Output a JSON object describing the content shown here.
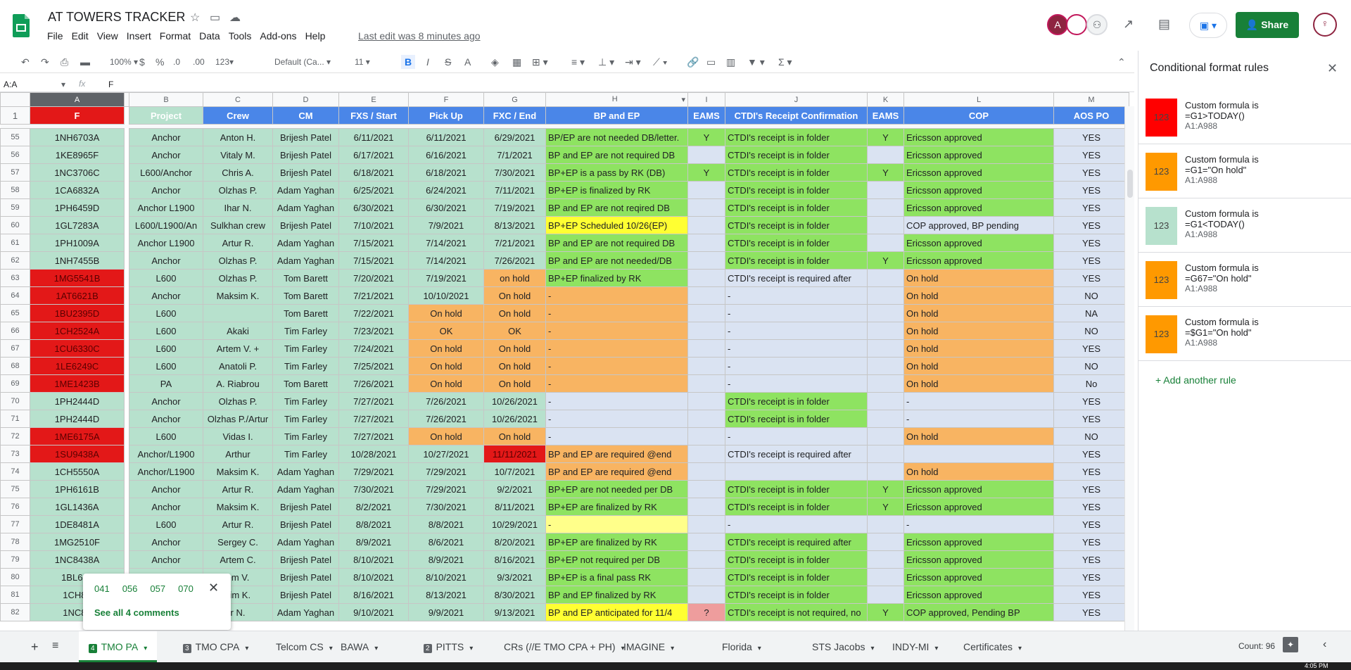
{
  "doc": {
    "title": "AT TOWERS TRACKER",
    "last_edit": "Last edit was 8 minutes ago"
  },
  "menu": [
    "File",
    "Edit",
    "View",
    "Insert",
    "Format",
    "Data",
    "Tools",
    "Add-ons",
    "Help"
  ],
  "header": {
    "avatar_letter": "A",
    "share_label": "Share"
  },
  "toolbar": {
    "zoom": "100%",
    "currency": "$",
    "percent": "%",
    "dec_dec": ".0",
    "dec_inc": ".00",
    "format_more": "123",
    "font": "Default (Ca...",
    "size": "11",
    "bold": "B",
    "italic": "I",
    "strike": "S",
    "textcolor": "A"
  },
  "formula": {
    "name_box": "A:A",
    "fx": "fx",
    "value": "F"
  },
  "columns": [
    "A",
    "B",
    "C",
    "D",
    "E",
    "F",
    "G",
    "H",
    "I",
    "J",
    "K",
    "L",
    "M"
  ],
  "headers": [
    "F",
    "Project",
    "Crew",
    "CM",
    "FXS / Start",
    "Pick Up",
    "FXC / End",
    "BP and EP",
    "EAMS",
    "CTDI's Receipt Confirmation",
    "EAMS",
    "COP",
    "AOS PO"
  ],
  "header_row_num": "1",
  "rows": [
    {
      "n": "55",
      "c": [
        "1NH6703A",
        "Anchor",
        "Anton H.",
        "Brijesh Patel",
        "6/11/2021",
        "6/11/2021",
        "6/29/2021",
        "BP/EP are not needed DB/letter.",
        "Y",
        "CTDI's receipt is in folder",
        "Y",
        "Ericsson approved",
        "YES"
      ],
      "s": [
        "teal",
        "teal",
        "teal",
        "teal",
        "teal",
        "teal",
        "teal",
        "green",
        "green",
        "green",
        "green",
        "green",
        "blue"
      ]
    },
    {
      "n": "56",
      "c": [
        "1KE8965F",
        "Anchor",
        "Vitaly M.",
        "Brijesh Patel",
        "6/17/2021",
        "6/16/2021",
        "7/1/2021",
        "BP and EP are not required DB",
        "",
        "CTDI's receipt is in folder",
        "",
        "Ericsson approved",
        "YES"
      ],
      "s": [
        "teal",
        "teal",
        "teal",
        "teal",
        "teal",
        "teal",
        "teal",
        "green",
        "blue",
        "green",
        "blue",
        "green",
        "blue"
      ]
    },
    {
      "n": "57",
      "c": [
        "1NC3706C",
        "L600/Anchor",
        "Chris A.",
        "Brijesh Patel",
        "6/18/2021",
        "6/18/2021",
        "7/30/2021",
        "BP+EP is a pass by RK (DB)",
        "Y",
        "CTDI's receipt is in folder",
        "Y",
        "Ericsson approved",
        "YES"
      ],
      "s": [
        "teal",
        "teal",
        "teal",
        "teal",
        "teal",
        "teal",
        "teal",
        "green",
        "green",
        "green",
        "green",
        "green",
        "blue"
      ]
    },
    {
      "n": "58",
      "c": [
        "1CA6832A",
        "Anchor",
        "Olzhas P.",
        "Adam Yaghan",
        "6/25/2021",
        "6/24/2021",
        "7/11/2021",
        "BP+EP is finalized by RK",
        "",
        "CTDI's receipt is in folder",
        "",
        "Ericsson approved",
        "YES"
      ],
      "s": [
        "teal",
        "teal",
        "teal",
        "teal",
        "teal",
        "teal",
        "teal",
        "green",
        "blue",
        "green",
        "blue",
        "green",
        "blue"
      ]
    },
    {
      "n": "59",
      "c": [
        "1PH6459D",
        "Anchor L1900",
        "Ihar N.",
        "Adam Yaghan",
        "6/30/2021",
        "6/30/2021",
        "7/19/2021",
        "BP and EP are not reqired DB",
        "",
        "CTDI's receipt is in folder",
        "",
        "Ericsson approved",
        "YES"
      ],
      "s": [
        "teal",
        "teal",
        "teal",
        "teal",
        "teal",
        "teal",
        "teal",
        "green",
        "blue",
        "green",
        "blue",
        "green",
        "blue"
      ]
    },
    {
      "n": "60",
      "c": [
        "1GL7283A",
        "L600/L1900/An",
        "Sulkhan crew",
        "Brijesh Patel",
        "7/10/2021",
        "7/9/2021",
        "8/13/2021",
        "BP+EP Scheduled 10/26(EP)",
        "",
        "CTDI's receipt is in folder",
        "",
        "COP approved, BP pending",
        "YES"
      ],
      "s": [
        "teal",
        "teal",
        "teal",
        "teal",
        "teal",
        "teal",
        "teal",
        "yellow",
        "blue",
        "green",
        "blue",
        "blue",
        "blue"
      ]
    },
    {
      "n": "61",
      "c": [
        "1PH1009A",
        "Anchor L1900",
        "Artur R.",
        "Adam Yaghan",
        "7/15/2021",
        "7/14/2021",
        "7/21/2021",
        "BP and EP are not required DB",
        "",
        "CTDI's receipt is in folder",
        "",
        "Ericsson approved",
        "YES"
      ],
      "s": [
        "teal",
        "teal",
        "teal",
        "teal",
        "teal",
        "teal",
        "teal",
        "green",
        "blue",
        "green",
        "blue",
        "green",
        "blue"
      ]
    },
    {
      "n": "62",
      "c": [
        "1NH7455B",
        "Anchor",
        "Olzhas P.",
        "Adam Yaghan",
        "7/15/2021",
        "7/14/2021",
        "7/26/2021",
        "BP and EP are not needed/DB",
        "",
        "CTDI's receipt is in folder",
        "Y",
        "Ericsson approved",
        "YES"
      ],
      "s": [
        "teal",
        "teal",
        "teal",
        "teal",
        "teal",
        "teal",
        "teal",
        "green",
        "blue",
        "green",
        "green",
        "green",
        "blue"
      ]
    },
    {
      "n": "63",
      "c": [
        "1MG5541B",
        "L600",
        "Olzhas P.",
        "Tom Barett",
        "7/20/2021",
        "7/19/2021",
        "on hold",
        "BP+EP finalized by RK",
        "",
        "CTDI's receipt is required after",
        "",
        "On hold",
        "YES"
      ],
      "s": [
        "red",
        "teal",
        "teal",
        "teal",
        "teal",
        "teal",
        "orange",
        "green",
        "blue",
        "blue",
        "blue",
        "orange",
        "blue"
      ]
    },
    {
      "n": "64",
      "c": [
        "1AT6621B",
        "Anchor",
        "Maksim K.",
        "Tom Barett",
        "7/21/2021",
        "10/10/2021",
        "On hold",
        "-",
        "",
        "-",
        "",
        "On hold",
        "NO"
      ],
      "s": [
        "red",
        "teal",
        "teal",
        "teal",
        "teal",
        "teal",
        "orange",
        "orange",
        "blue",
        "blue",
        "blue",
        "orange",
        "blue"
      ]
    },
    {
      "n": "65",
      "c": [
        "1BU2395D",
        "L600",
        "",
        "Tom Barett",
        "7/22/2021",
        "On hold",
        "On hold",
        "-",
        "",
        "-",
        "",
        "On hold",
        "NA"
      ],
      "s": [
        "red",
        "teal",
        "teal",
        "teal",
        "teal",
        "orange",
        "orange",
        "orange",
        "blue",
        "blue",
        "blue",
        "orange",
        "blue"
      ]
    },
    {
      "n": "66",
      "c": [
        "1CH2524A",
        "L600",
        "Akaki",
        "Tim Farley",
        "7/23/2021",
        "OK",
        "OK",
        "-",
        "",
        "-",
        "",
        "On hold",
        "NO"
      ],
      "s": [
        "red",
        "teal",
        "teal",
        "teal",
        "teal",
        "orange",
        "orange",
        "orange",
        "blue",
        "blue",
        "blue",
        "orange",
        "blue"
      ]
    },
    {
      "n": "67",
      "c": [
        "1CU6330C",
        "L600",
        "Artem V. +",
        "Tim Farley",
        "7/24/2021",
        "On hold",
        "On hold",
        "-",
        "",
        "-",
        "",
        "On hold",
        "YES"
      ],
      "s": [
        "red",
        "teal",
        "teal",
        "teal",
        "teal",
        "orange",
        "orange",
        "orange",
        "blue",
        "blue",
        "blue",
        "orange",
        "blue"
      ]
    },
    {
      "n": "68",
      "c": [
        "1LE6249C",
        "L600",
        "Anatoli P.",
        "Tim Farley",
        "7/25/2021",
        "On hold",
        "On hold",
        "-",
        "",
        "-",
        "",
        "On hold",
        "NO"
      ],
      "s": [
        "red",
        "teal",
        "teal",
        "teal",
        "teal",
        "orange",
        "orange",
        "orange",
        "blue",
        "blue",
        "blue",
        "orange",
        "blue"
      ]
    },
    {
      "n": "69",
      "c": [
        "1ME1423B",
        "PA",
        "A. Riabrou",
        "Tom Barett",
        "7/26/2021",
        "On hold",
        "On hold",
        "-",
        "",
        "-",
        "",
        "On hold",
        "No"
      ],
      "s": [
        "red",
        "teal",
        "teal",
        "teal",
        "teal",
        "orange",
        "orange",
        "orange",
        "blue",
        "blue",
        "blue",
        "orange",
        "blue"
      ]
    },
    {
      "n": "70",
      "c": [
        "1PH2444D",
        "Anchor",
        "Olzhas P.",
        "Tim Farley",
        "7/27/2021",
        "7/26/2021",
        "10/26/2021",
        "-",
        "",
        "CTDI's receipt is in folder",
        "",
        "-",
        "YES"
      ],
      "s": [
        "teal",
        "teal",
        "teal",
        "teal",
        "teal",
        "teal",
        "teal",
        "blue",
        "blue",
        "green",
        "blue",
        "blue",
        "blue"
      ]
    },
    {
      "n": "71",
      "c": [
        "1PH2444D",
        "Anchor",
        "Olzhas P./Artur",
        "Tim Farley",
        "7/27/2021",
        "7/26/2021",
        "10/26/2021",
        "-",
        "",
        "CTDI's receipt is in folder",
        "",
        "-",
        "YES"
      ],
      "s": [
        "teal",
        "teal",
        "teal",
        "teal",
        "teal",
        "teal",
        "teal",
        "blue",
        "blue",
        "green",
        "blue",
        "blue",
        "blue"
      ]
    },
    {
      "n": "72",
      "c": [
        "1ME6175A",
        "L600",
        "Vidas I.",
        "Tim Farley",
        "7/27/2021",
        "On hold",
        "On hold",
        "-",
        "",
        "-",
        "",
        "On hold",
        "NO"
      ],
      "s": [
        "red",
        "teal",
        "teal",
        "teal",
        "teal",
        "orange",
        "orange",
        "blue",
        "blue",
        "blue",
        "blue",
        "orange",
        "blue"
      ]
    },
    {
      "n": "73",
      "c": [
        "1SU9438A",
        "Anchor/L1900",
        "Arthur",
        "Tim Farley",
        "10/28/2021",
        "10/27/2021",
        "11/11/2021",
        "BP and EP are required @end",
        "",
        "CTDI's receipt is required after",
        "",
        "",
        "YES"
      ],
      "s": [
        "red",
        "teal",
        "teal",
        "teal",
        "teal",
        "teal",
        "red",
        "orange",
        "blue",
        "blue",
        "blue",
        "blue",
        "blue"
      ]
    },
    {
      "n": "74",
      "c": [
        "1CH5550A",
        "Anchor/L1900",
        "Maksim K.",
        "Adam Yaghan",
        "7/29/2021",
        "7/29/2021",
        "10/7/2021",
        "BP and EP are required @end",
        "",
        "",
        "",
        "On hold",
        "YES"
      ],
      "s": [
        "teal",
        "teal",
        "teal",
        "teal",
        "teal",
        "teal",
        "teal",
        "orange",
        "blue",
        "blue",
        "blue",
        "orange",
        "blue"
      ]
    },
    {
      "n": "75",
      "c": [
        "1PH6161B",
        "Anchor",
        "Artur R.",
        "Adam Yaghan",
        "7/30/2021",
        "7/29/2021",
        "9/2/2021",
        "BP+EP are not needed per DB",
        "",
        "CTDI's receipt is in folder",
        "Y",
        "Ericsson approved",
        "YES"
      ],
      "s": [
        "teal",
        "teal",
        "teal",
        "teal",
        "teal",
        "teal",
        "teal",
        "green",
        "blue",
        "green",
        "green",
        "green",
        "blue"
      ]
    },
    {
      "n": "76",
      "c": [
        "1GL1436A",
        "Anchor",
        "Maksim K.",
        "Brijesh Patel",
        "8/2/2021",
        "7/30/2021",
        "8/11/2021",
        "BP+EP are finalized by RK",
        "",
        "CTDI's receipt is in folder",
        "Y",
        "Ericsson approved",
        "YES"
      ],
      "s": [
        "teal",
        "teal",
        "teal",
        "teal",
        "teal",
        "teal",
        "teal",
        "green",
        "blue",
        "green",
        "green",
        "green",
        "blue"
      ]
    },
    {
      "n": "77",
      "c": [
        "1DE8481A",
        "L600",
        "Artur R.",
        "Brijesh Patel",
        "8/8/2021",
        "8/8/2021",
        "10/29/2021",
        "-",
        "",
        "-",
        "",
        "-",
        "YES"
      ],
      "s": [
        "teal",
        "teal",
        "teal",
        "teal",
        "teal",
        "teal",
        "teal",
        "lyellow",
        "blue",
        "blue",
        "blue",
        "blue",
        "blue"
      ]
    },
    {
      "n": "78",
      "c": [
        "1MG2510F",
        "Anchor",
        "Sergey C.",
        "Adam Yaghan",
        "8/9/2021",
        "8/6/2021",
        "8/20/2021",
        "BP+EP are finalized by RK",
        "",
        "CTDI's receipt is required after",
        "",
        "Ericsson approved",
        "YES"
      ],
      "s": [
        "teal",
        "teal",
        "teal",
        "teal",
        "teal",
        "teal",
        "teal",
        "green",
        "blue",
        "green",
        "blue",
        "green",
        "blue"
      ]
    },
    {
      "n": "79",
      "c": [
        "1NC8438A",
        "Anchor",
        "Artem C.",
        "Brijesh Patel",
        "8/10/2021",
        "8/9/2021",
        "8/16/2021",
        "BP+EP not required per DB",
        "",
        "CTDI's receipt is in folder",
        "",
        "Ericsson approved",
        "YES"
      ],
      "s": [
        "teal",
        "teal",
        "teal",
        "teal",
        "teal",
        "teal",
        "teal",
        "green",
        "blue",
        "green",
        "blue",
        "green",
        "blue"
      ]
    },
    {
      "n": "80",
      "c": [
        "1BL626",
        "",
        "em V.",
        "Brijesh Patel",
        "8/10/2021",
        "8/10/2021",
        "9/3/2021",
        "BP+EP is a final pass RK",
        "",
        "CTDI's receipt is in folder",
        "",
        "Ericsson approved",
        "YES"
      ],
      "s": [
        "teal",
        "teal",
        "teal",
        "teal",
        "teal",
        "teal",
        "teal",
        "green",
        "blue",
        "green",
        "blue",
        "green",
        "blue"
      ]
    },
    {
      "n": "81",
      "c": [
        "1CH89",
        "",
        "sim K.",
        "Brijesh Patel",
        "8/16/2021",
        "8/13/2021",
        "8/30/2021",
        "BP and EP finalized by RK",
        "",
        "CTDI's receipt is in folder",
        "",
        "Ericsson approved",
        "YES"
      ],
      "s": [
        "teal",
        "teal",
        "teal",
        "teal",
        "teal",
        "teal",
        "teal",
        "green",
        "blue",
        "green",
        "blue",
        "green",
        "blue"
      ]
    },
    {
      "n": "82",
      "c": [
        "1NC88",
        "",
        "r N.",
        "Adam Yaghan",
        "9/10/2021",
        "9/9/2021",
        "9/13/2021",
        "BP and EP anticipated for 11/4",
        "?",
        "CTDI's receipt is not required, no",
        "Y",
        "COP approved, Pending BP",
        "YES"
      ],
      "s": [
        "teal",
        "teal",
        "teal",
        "teal",
        "teal",
        "teal",
        "teal",
        "yellow",
        "pink",
        "green",
        "green",
        "green",
        "blue"
      ]
    }
  ],
  "panel": {
    "title": "Conditional format rules",
    "rules": [
      {
        "swatch": "123",
        "color": "#ff0000",
        "label": "Custom formula is",
        "formula": "=G1>TODAY()",
        "range": "A1:A988"
      },
      {
        "swatch": "123",
        "color": "#ff9900",
        "label": "Custom formula is",
        "formula": "=G1=\"On hold\"",
        "range": "A1:A988"
      },
      {
        "swatch": "123",
        "color": "#b7e1cd",
        "label": "Custom formula is",
        "formula": "=G1<TODAY()",
        "range": "A1:A988"
      },
      {
        "swatch": "123",
        "color": "#ff9900",
        "label": "Custom formula is",
        "formula": "=G67=\"On hold\"",
        "range": "A1:A988"
      },
      {
        "swatch": "123",
        "color": "#ff9900",
        "label": "Custom formula is",
        "formula": "=$G1=\"On hold\"",
        "range": "A1:A988"
      }
    ],
    "add_rule": "Add another rule"
  },
  "comments": {
    "tags": [
      "041",
      "056",
      "057",
      "070"
    ],
    "see_all": "See all 4 comments"
  },
  "tabs": [
    "TMO PA",
    "TMO CPA",
    "Telcom CS",
    "BAWA",
    "PITTS",
    "CRs (//E TMO CPA + PH)",
    "IMAGINE",
    "Florida",
    "STS Jacobs",
    "INDY-MI",
    "Certificates"
  ],
  "tab_badges": {
    "0": "4",
    "1": "3",
    "4": "2"
  },
  "status": {
    "count": "Count: 96",
    "time": "4:05 PM"
  }
}
